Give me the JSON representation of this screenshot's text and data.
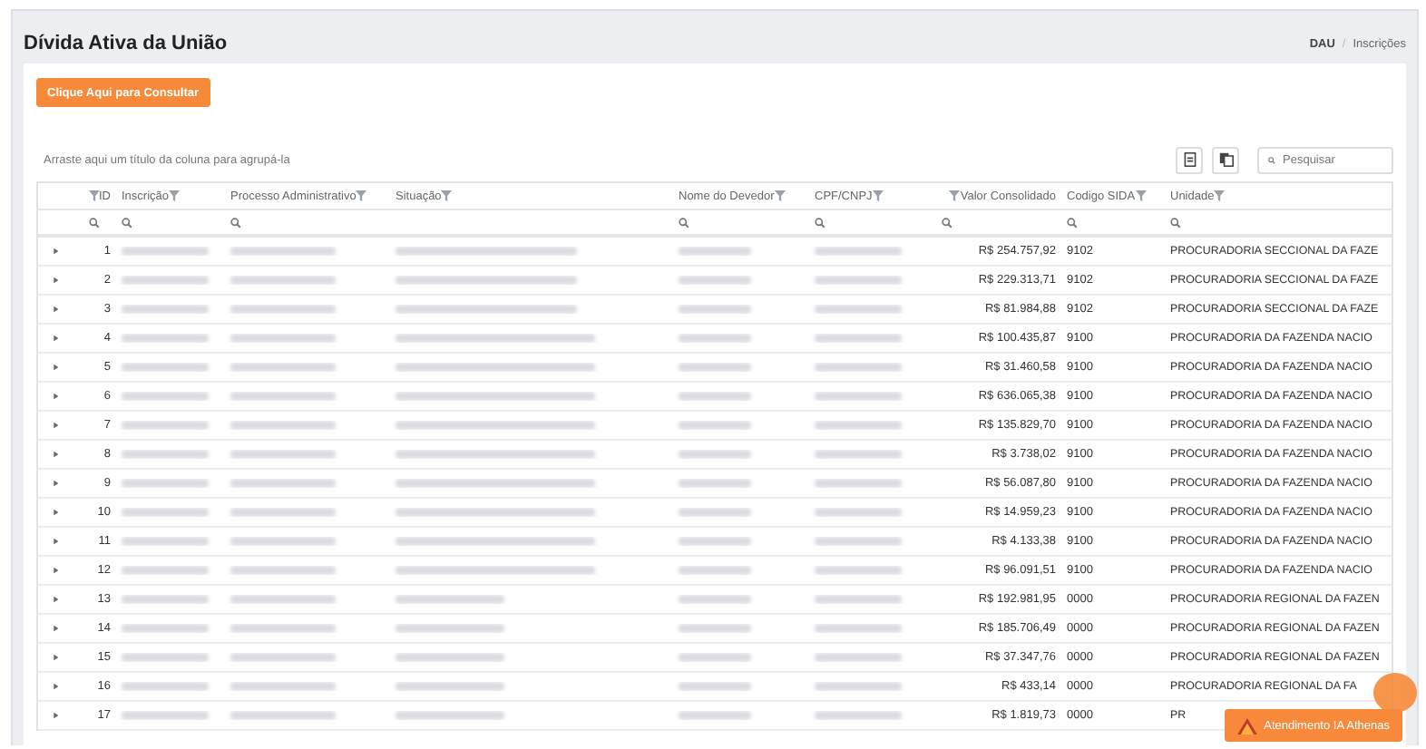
{
  "title": "Dívida Ativa da União",
  "breadcrumb_separator": "/",
  "breadcrumb": [
    {
      "label": "DAU",
      "current": false
    },
    {
      "label": "Inscrições",
      "current": true
    }
  ],
  "consult_button": "Clique Aqui para Consultar",
  "group_hint": "Arraste aqui um título da coluna para agrupá-la",
  "search": {
    "placeholder": "Pesquisar"
  },
  "columns": [
    {
      "label": "ID",
      "kind": "number"
    },
    {
      "label": "Inscrição",
      "kind": "text"
    },
    {
      "label": "Processo Administrativo",
      "kind": "text"
    },
    {
      "label": "Situação",
      "kind": "text"
    },
    {
      "label": "Nome do Devedor",
      "kind": "text"
    },
    {
      "label": "CPF/CNPJ",
      "kind": "text"
    },
    {
      "label": "Valor Consolidado",
      "kind": "number"
    },
    {
      "label": "Codigo SIDA",
      "kind": "text"
    },
    {
      "label": "Unidade",
      "kind": "text"
    }
  ],
  "rows": [
    {
      "id": "1",
      "valor": "R$ 254.757,92",
      "codigo": "9102",
      "unidade": "PROCURADORIA SECCIONAL DA FAZE",
      "expanded": false
    },
    {
      "id": "2",
      "valor": "R$ 229.313,71",
      "codigo": "9102",
      "unidade": "PROCURADORIA SECCIONAL DA FAZE",
      "expanded": false
    },
    {
      "id": "3",
      "valor": "R$ 81.984,88",
      "codigo": "9102",
      "unidade": "PROCURADORIA SECCIONAL DA FAZE",
      "expanded": false
    },
    {
      "id": "4",
      "valor": "R$ 100.435,87",
      "codigo": "9100",
      "unidade": "PROCURADORIA DA FAZENDA NACIO",
      "expanded": false
    },
    {
      "id": "5",
      "valor": "R$ 31.460,58",
      "codigo": "9100",
      "unidade": "PROCURADORIA DA FAZENDA NACIO",
      "expanded": false
    },
    {
      "id": "6",
      "valor": "R$ 636.065,38",
      "codigo": "9100",
      "unidade": "PROCURADORIA DA FAZENDA NACIO",
      "expanded": false
    },
    {
      "id": "7",
      "valor": "R$ 135.829,70",
      "codigo": "9100",
      "unidade": "PROCURADORIA DA FAZENDA NACIO",
      "expanded": false
    },
    {
      "id": "8",
      "valor": "R$ 3.738,02",
      "codigo": "9100",
      "unidade": "PROCURADORIA DA FAZENDA NACIO",
      "expanded": false
    },
    {
      "id": "9",
      "valor": "R$ 56.087,80",
      "codigo": "9100",
      "unidade": "PROCURADORIA DA FAZENDA NACIO",
      "expanded": false
    },
    {
      "id": "10",
      "valor": "R$ 14.959,23",
      "codigo": "9100",
      "unidade": "PROCURADORIA DA FAZENDA NACIO",
      "expanded": false
    },
    {
      "id": "11",
      "valor": "R$ 4.133,38",
      "codigo": "9100",
      "unidade": "PROCURADORIA DA FAZENDA NACIO",
      "expanded": false
    },
    {
      "id": "12",
      "valor": "R$ 96.091,51",
      "codigo": "9100",
      "unidade": "PROCURADORIA DA FAZENDA NACIO",
      "expanded": false
    },
    {
      "id": "13",
      "valor": "R$ 192.981,95",
      "codigo": "0000",
      "unidade": "PROCURADORIA REGIONAL DA FAZEN",
      "expanded": false
    },
    {
      "id": "14",
      "valor": "R$ 185.706,49",
      "codigo": "0000",
      "unidade": "PROCURADORIA REGIONAL DA FAZEN",
      "expanded": false
    },
    {
      "id": "15",
      "valor": "R$ 37.347,76",
      "codigo": "0000",
      "unidade": "PROCURADORIA REGIONAL DA FAZEN",
      "expanded": false
    },
    {
      "id": "16",
      "valor": "R$ 433,14",
      "codigo": "0000",
      "unidade": "PROCURADORIA REGIONAL DA FA",
      "expanded": false
    },
    {
      "id": "17",
      "valor": "R$ 1.819,73",
      "codigo": "0000",
      "unidade": "PR",
      "expanded": false
    }
  ],
  "chat_button": "Atendimento IA Athenas"
}
